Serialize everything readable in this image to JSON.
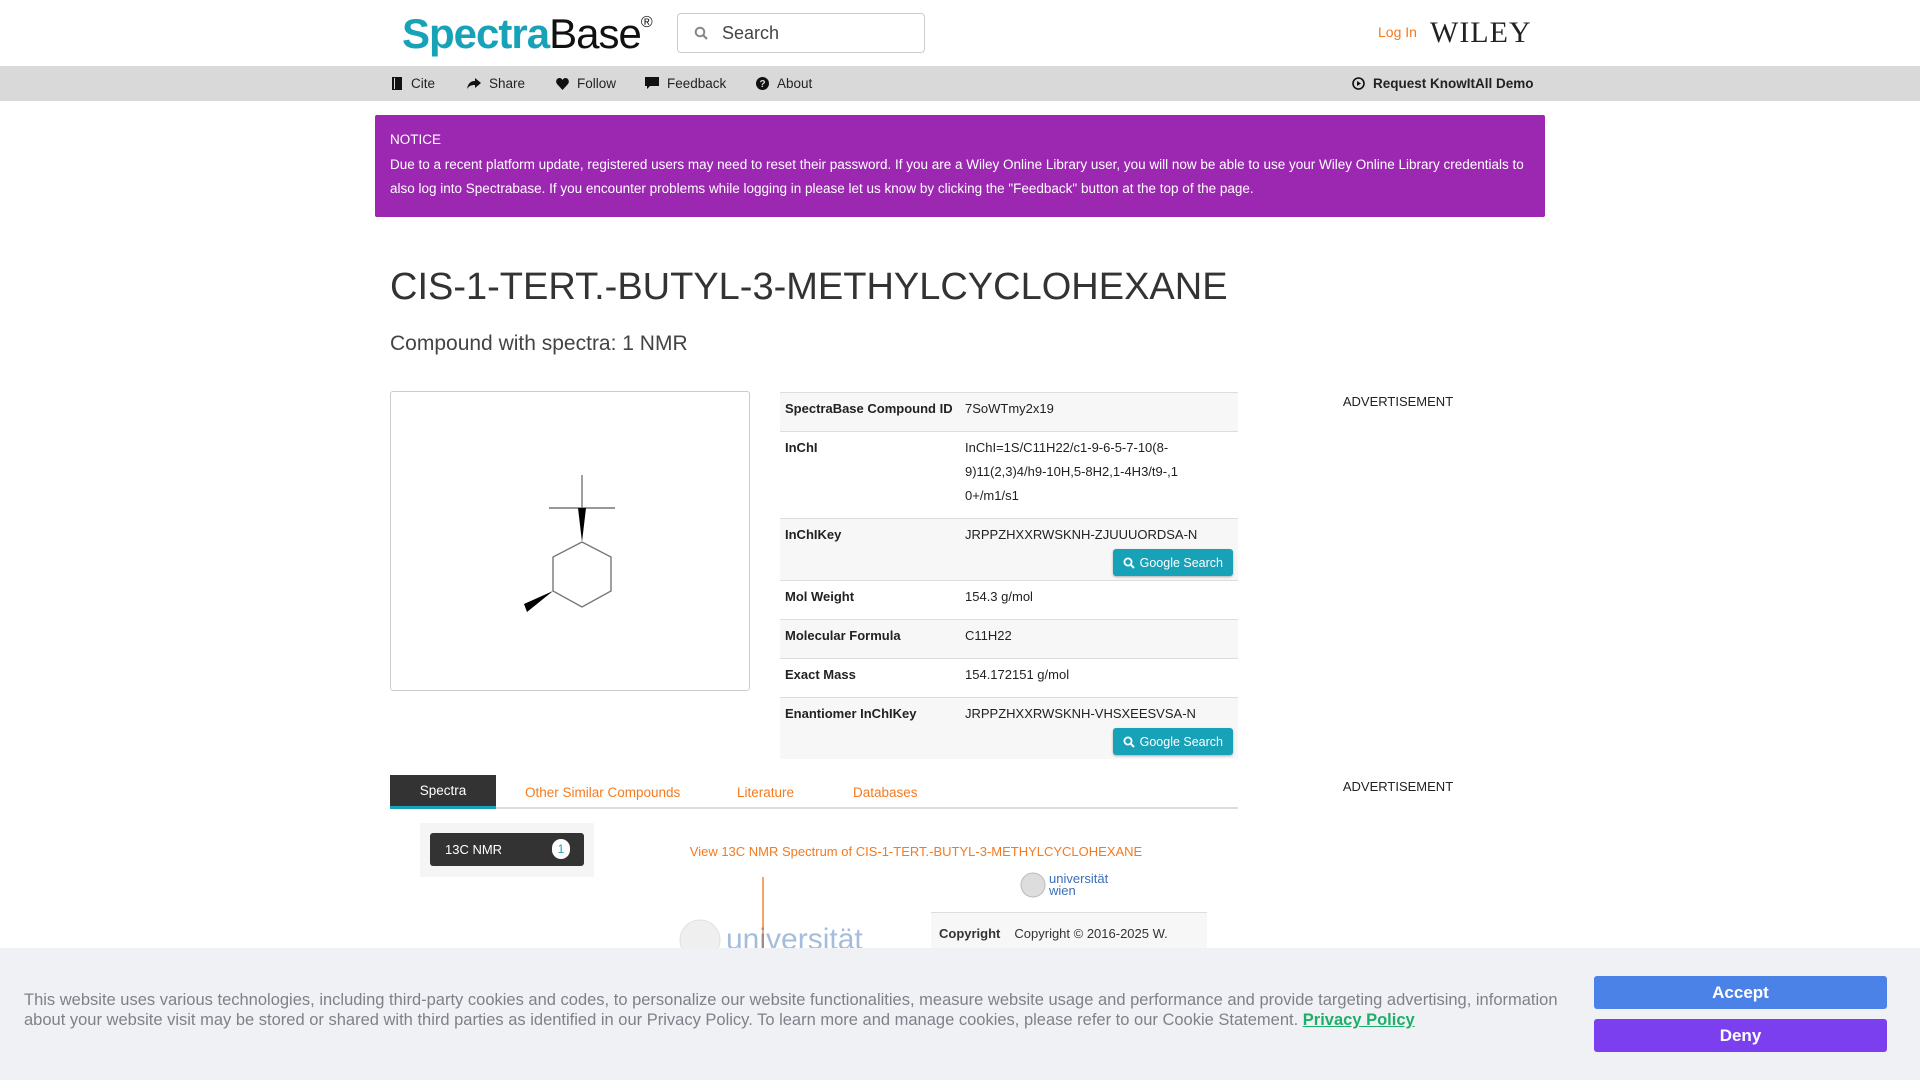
{
  "header": {
    "logo_part1": "Spectra",
    "logo_part2": "Base",
    "logo_mark": "®",
    "search_placeholder": "Search",
    "login": "Log In",
    "wiley_logo": "WILEY"
  },
  "nav": {
    "items": [
      {
        "label": "Cite",
        "icon": "book-icon"
      },
      {
        "label": "Share",
        "icon": "share-icon"
      },
      {
        "label": "Follow",
        "icon": "heart-icon"
      },
      {
        "label": "Feedback",
        "icon": "comment-icon"
      },
      {
        "label": "About",
        "icon": "question-circle-icon"
      }
    ],
    "demo": "Request KnowItAll Demo"
  },
  "notice": {
    "title": "NOTICE",
    "text": "Due to a recent platform update, registered users may need to reset their password. If you are a Wiley Online Library user, you will now be able to use your Wiley Online Library credentials to also log into Spectrabase. If you encounter problems while logging in please let us know by clicking the \"Feedback\" button at the top of the page."
  },
  "compound": {
    "title": "CIS-1-TERT.-BUTYL-3-METHYLCYCLOHEXANE",
    "subtitle": "Compound with spectra: 1 NMR"
  },
  "properties": [
    {
      "label": "SpectraBase Compound ID",
      "value": "7SoWTmy2x19"
    },
    {
      "label": "InChI",
      "value": "InChI=1S/C11H22/c1-9-6-5-7-10(8-9)11(2,3)4/h9-10H,5-8H2,1-4H3/t9-,10+/m1/s1"
    },
    {
      "label": "InChIKey",
      "value": "JRPPZHXXRWSKNH-ZJUUUORDSA-N",
      "button": "Google Search"
    },
    {
      "label": "Mol Weight",
      "value": "154.3 g/mol"
    },
    {
      "label": "Molecular Formula",
      "value": "C11H22"
    },
    {
      "label": "Exact Mass",
      "value": "154.172151 g/mol"
    },
    {
      "label": "Enantiomer InChIKey",
      "value": "JRPPZHXXRWSKNH-VHSXEESVSA-N",
      "button": "Google Search"
    }
  ],
  "ads": [
    "ADVERTISEMENT",
    "ADVERTISEMENT"
  ],
  "tabs": [
    {
      "label": "Spectra",
      "active": true
    },
    {
      "label": "Other Similar Compounds"
    },
    {
      "label": "Literature"
    },
    {
      "label": "Databases"
    }
  ],
  "spectra": {
    "item": "13C NMR",
    "count": "1",
    "view_link": "View 13C NMR Spectrum of CIS-1-TERT.-BUTYL-3-METHYLCYCLOHEXANE",
    "logo_text": "universität wien",
    "copyright_label": "Copyright",
    "copyright_value": "Copyright © 2016-2025 W."
  },
  "cookie": {
    "text": "This website uses various technologies, including third-party cookies and codes, to personalize our website functionalities, measure website usage and performance and provide targeting advertising, information about your website visit may be stored or shared with third parties as identified in our Privacy Policy. To learn more and manage cookies, please refer to our Cookie Statement. ",
    "privacy_link": "Privacy Policy",
    "accept": "Accept",
    "deny": "Deny"
  },
  "colors": {
    "brand": "#17a2b8",
    "accent": "#f47a20",
    "notice": "#9c27b0",
    "accept": "#4a82e8",
    "deny": "#7b3fef"
  }
}
